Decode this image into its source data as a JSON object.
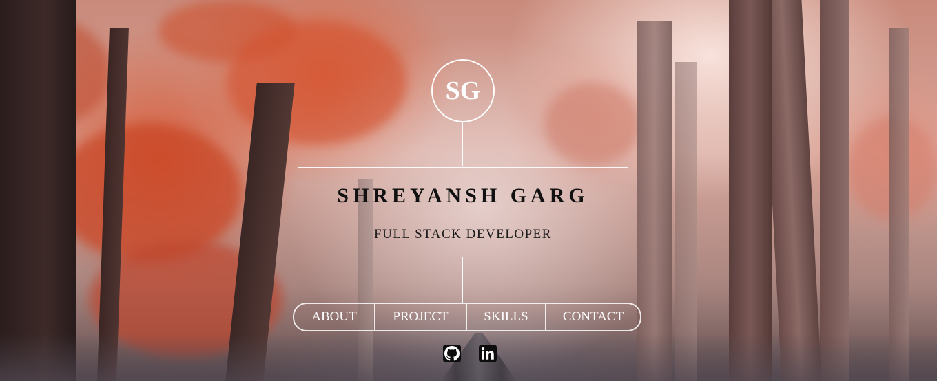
{
  "brand": {
    "monogram": "SG"
  },
  "hero": {
    "name": "SHREYANSH GARG",
    "subtitle": "FULL STACK DEVELOPER"
  },
  "nav": {
    "items": [
      {
        "label": "ABOUT"
      },
      {
        "label": "PROJECT"
      },
      {
        "label": "SKILLS"
      },
      {
        "label": "CONTACT"
      }
    ]
  },
  "social": {
    "icons": [
      "github-icon",
      "linkedin-icon"
    ]
  },
  "colors": {
    "text_light": "#ffffff",
    "text_dark": "#111111",
    "icon_bg": "#0d0d0d"
  }
}
